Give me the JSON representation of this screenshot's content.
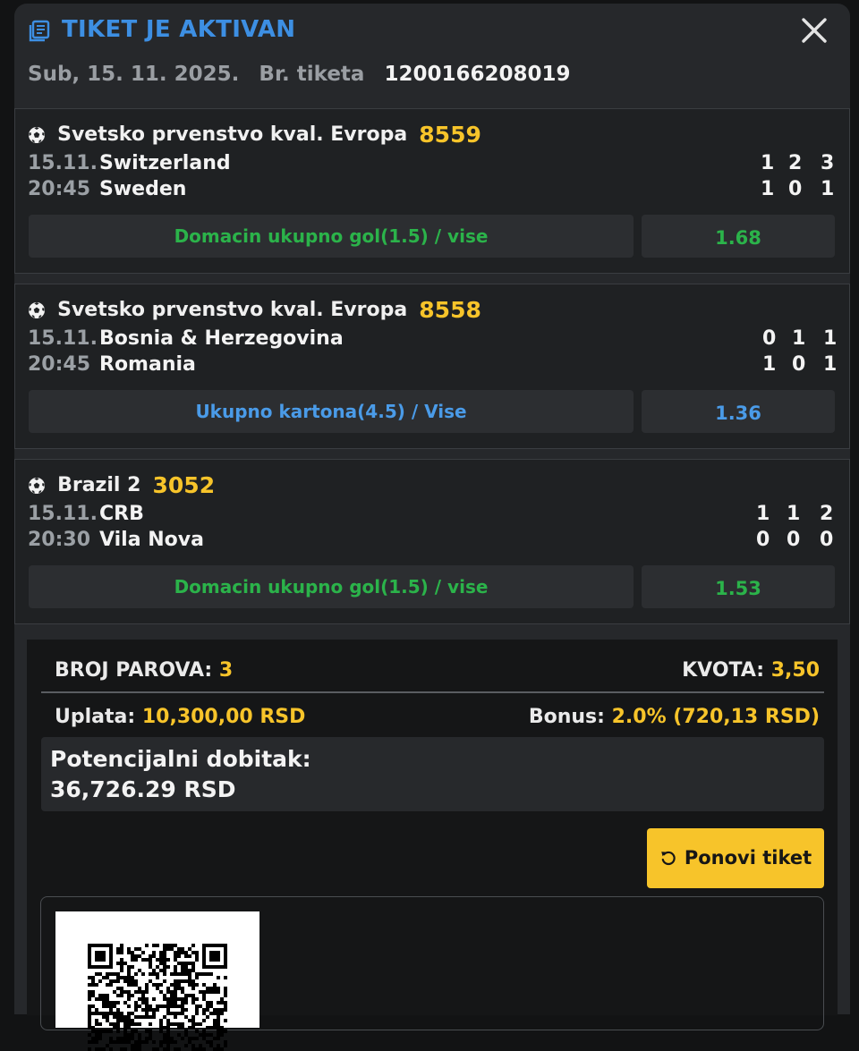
{
  "header": {
    "title": "TIKET JE AKTIVAN",
    "date": "Sub, 15. 11. 2025.",
    "ticket_label": "Br. tiketa",
    "ticket_number": "1200166208019"
  },
  "matches": [
    {
      "league": "Svetsko prvenstvo kval. Evropa",
      "code": "8559",
      "date": "15.11.",
      "time": "20:45",
      "home": "Switzerland",
      "away": "Sweden",
      "home_scores": [
        "1",
        "2",
        "3"
      ],
      "away_scores": [
        "1",
        "0",
        "1"
      ],
      "pick": "Domacin ukupno gol(1.5) / vise",
      "odd": "1.68",
      "status_color": "#2bb34a"
    },
    {
      "league": "Svetsko prvenstvo kval. Evropa",
      "code": "8558",
      "date": "15.11.",
      "time": "20:45",
      "home": "Bosnia & Herzegovina",
      "away": "Romania",
      "home_scores": [
        "0",
        "1",
        "1"
      ],
      "away_scores": [
        "1",
        "0",
        "1"
      ],
      "pick": "Ukupno kartona(4.5) / Vise",
      "odd": "1.36",
      "status_color": "#4a9be8"
    },
    {
      "league": "Brazil 2",
      "code": "3052",
      "date": "15.11.",
      "time": "20:30",
      "home": "CRB",
      "away": "Vila Nova",
      "home_scores": [
        "1",
        "1",
        "2"
      ],
      "away_scores": [
        "0",
        "0",
        "0"
      ],
      "pick": "Domacin ukupno gol(1.5) / vise",
      "odd": "1.53",
      "status_color": "#2bb34a"
    }
  ],
  "summary": {
    "pairs_label": "BROJ PAROVA:",
    "pairs_value": "3",
    "odds_label": "KVOTA:",
    "odds_value": "3,50",
    "stake_label": "Uplata:",
    "stake_value": "10,300,00 RSD",
    "bonus_label": "Bonus:",
    "bonus_value": "2.0% (720,13 RSD)",
    "potential_label": "Potencijalni dobitak:",
    "potential_value": "36,726.29 RSD",
    "repeat_button": "Ponovi tiket"
  },
  "icons": {
    "header": "ticket-icon",
    "close": "close-icon",
    "sport": "soccer-ball-icon",
    "repeat": "refresh-icon"
  },
  "colors": {
    "accent": "#f7c42a",
    "title_blue": "#3d8fe3",
    "win_green": "#2bb34a",
    "pick_blue": "#4a9be8"
  }
}
